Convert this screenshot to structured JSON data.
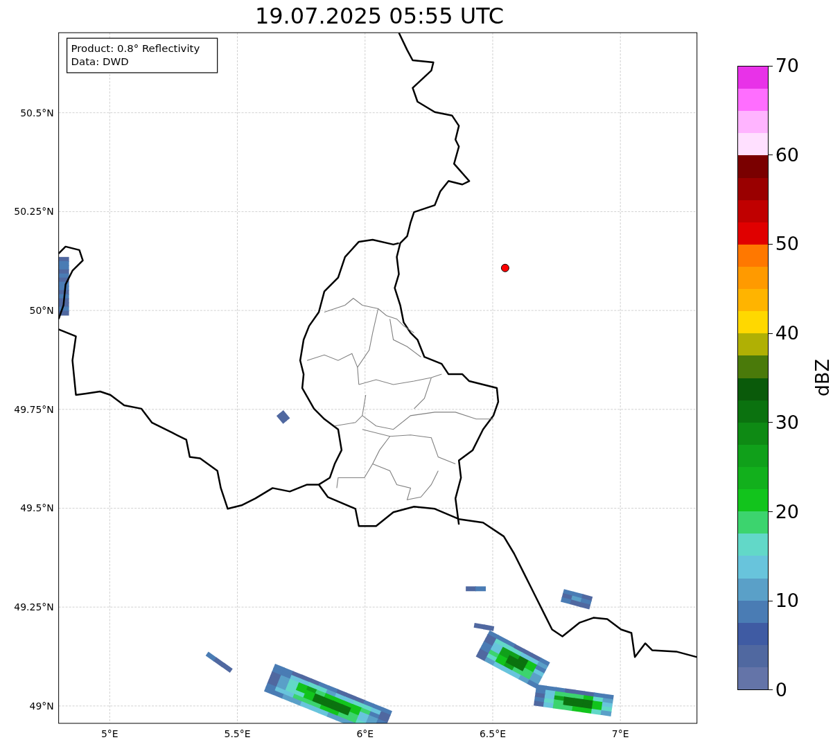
{
  "title": "19.07.2025 05:55 UTC",
  "info_box": [
    "Product: 0.8° Reflectivity",
    "Data: DWD"
  ],
  "map": {
    "xticks": [
      "5°E",
      "5.5°E",
      "6°E",
      "6.5°E",
      "7°E"
    ],
    "yticks": [
      "50.5°N",
      "50.25°N",
      "50°N",
      "49.75°N",
      "49.5°N",
      "49.25°N",
      "49°N"
    ]
  },
  "colorbar": {
    "label": "dBZ",
    "ticks": [
      "70",
      "60",
      "50",
      "40",
      "30",
      "20",
      "10",
      "0"
    ],
    "bins": [
      {
        "color": "#6474a8"
      },
      {
        "color": "#5068a0"
      },
      {
        "color": "#3f5ba3"
      },
      {
        "color": "#4a7cb4"
      },
      {
        "color": "#5aa0c8"
      },
      {
        "color": "#68c4dc"
      },
      {
        "color": "#62d8c8"
      },
      {
        "color": "#3cd46e"
      },
      {
        "color": "#12c41c"
      },
      {
        "color": "#12b01c"
      },
      {
        "color": "#10a01a"
      },
      {
        "color": "#0e8a14"
      },
      {
        "color": "#0b720f"
      },
      {
        "color": "#0a5a0a"
      },
      {
        "color": "#4a7a0a"
      },
      {
        "color": "#b0b004"
      },
      {
        "color": "#ffd800"
      },
      {
        "color": "#ffb400"
      },
      {
        "color": "#ff9a00"
      },
      {
        "color": "#ff7800"
      },
      {
        "color": "#e00000"
      },
      {
        "color": "#c00000"
      },
      {
        "color": "#9a0000"
      },
      {
        "color": "#7a0000"
      },
      {
        "color": "#ffe0ff"
      },
      {
        "color": "#ffb4ff"
      },
      {
        "color": "#ff6eff"
      },
      {
        "color": "#e832e8"
      }
    ]
  }
}
